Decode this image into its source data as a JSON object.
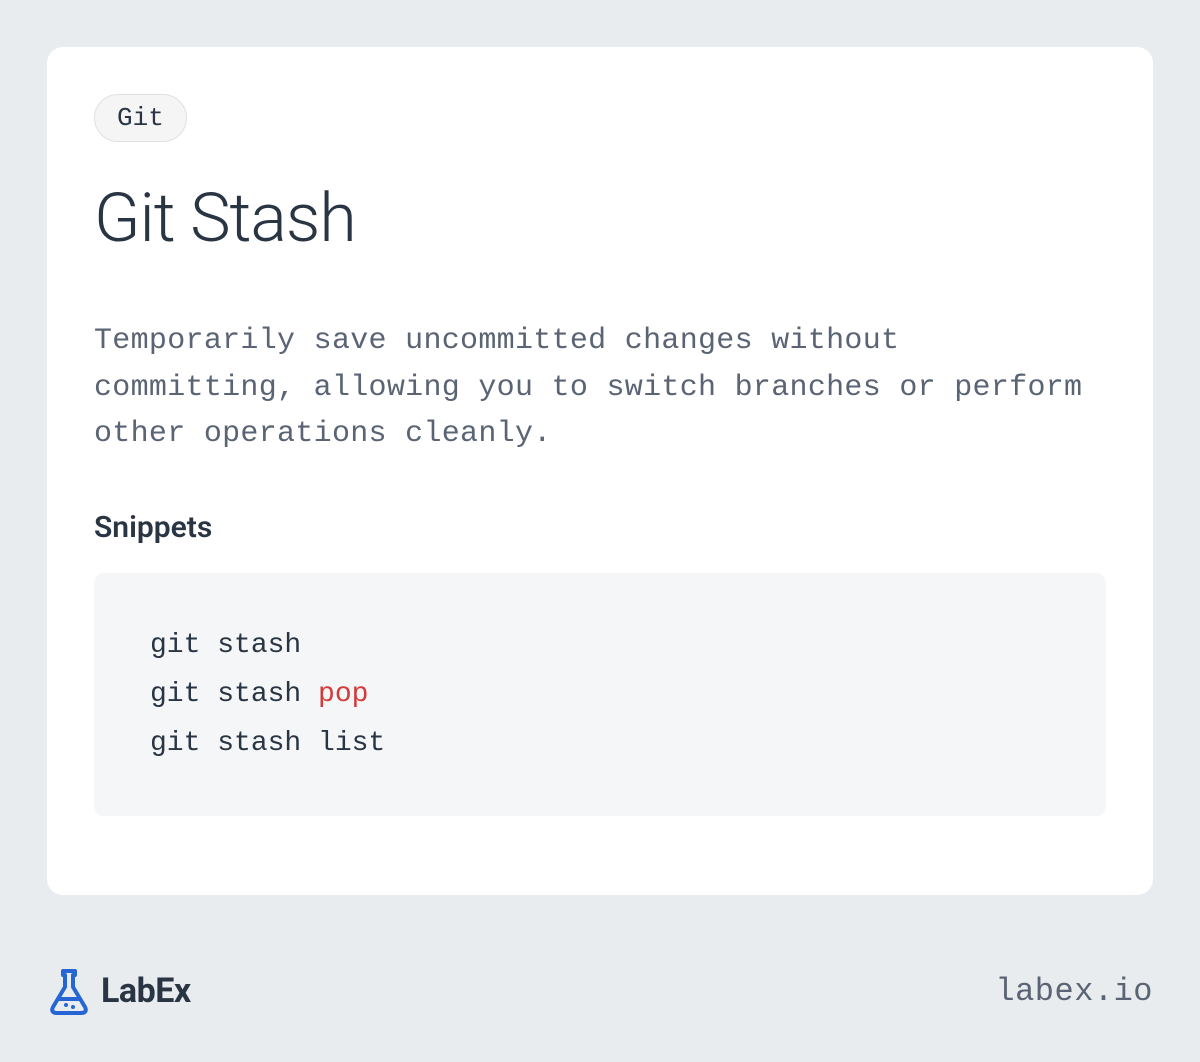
{
  "tag": "Git",
  "title": "Git Stash",
  "description": "Temporarily save uncommitted changes without committing, allowing you to switch branches or perform other operations cleanly.",
  "section_heading": "Snippets",
  "code": {
    "line1": "git stash",
    "line2_prefix": "git stash ",
    "line2_keyword": "pop",
    "line3": "git stash list"
  },
  "footer": {
    "brand_name": "LabEx",
    "site_url": "labex.io"
  }
}
